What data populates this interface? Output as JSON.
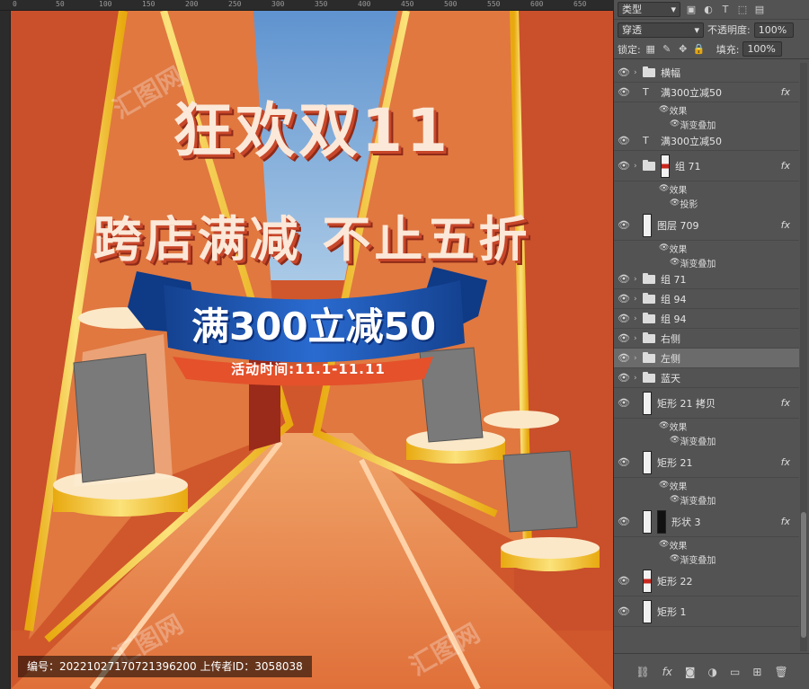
{
  "ruler": {
    "marks": [
      "0",
      "50",
      "100",
      "150",
      "200",
      "250",
      "300",
      "350",
      "400",
      "450",
      "500",
      "550",
      "600",
      "650"
    ]
  },
  "poster": {
    "headline1": "狂欢双11",
    "headline2": "跨店满减  不止五折",
    "banner": "满300立减50",
    "time": "活动时间:11.1-11.11",
    "watermark_text": "汇图网",
    "footer": "编号：20221027170721396200 上传者ID：3058038"
  },
  "colors": {
    "bg": "#d0572b",
    "gold": "#f2c230",
    "blue": "#1b4fa8",
    "road": "#e98a4c",
    "sky": "#6ea4d6"
  },
  "panel": {
    "filter_label": "类型",
    "blend_mode": "穿透",
    "opacity_label": "不透明度:",
    "opacity_value": "100%",
    "lock_label": "锁定:",
    "fill_label": "填充:",
    "fill_value": "100%",
    "layers": [
      {
        "name": "横幅",
        "kind": "folder",
        "fx": false
      },
      {
        "name": "满300立减50",
        "kind": "text",
        "fx": true
      },
      {
        "name": "效果",
        "kind": "sub"
      },
      {
        "name": "渐变叠加",
        "kind": "sub2"
      },
      {
        "name": "满300立减50",
        "kind": "text",
        "fx": false
      },
      {
        "name": "组 71",
        "kind": "group-thumb",
        "fx": true
      },
      {
        "name": "效果",
        "kind": "sub"
      },
      {
        "name": "投影",
        "kind": "sub2"
      },
      {
        "name": "图层 709",
        "kind": "layer",
        "fx": true
      },
      {
        "name": "效果",
        "kind": "sub"
      },
      {
        "name": "渐变叠加",
        "kind": "sub2"
      },
      {
        "name": "组 71",
        "kind": "folder",
        "fx": false
      },
      {
        "name": "组 94",
        "kind": "folder",
        "fx": false
      },
      {
        "name": "组 94",
        "kind": "folder",
        "fx": false
      },
      {
        "name": "右侧",
        "kind": "folder",
        "fx": false
      },
      {
        "name": "左侧",
        "kind": "folder",
        "fx": false,
        "selected": true
      },
      {
        "name": "蓝天",
        "kind": "folder",
        "fx": false
      },
      {
        "name": "矩形 21 拷贝",
        "kind": "layer",
        "fx": true
      },
      {
        "name": "效果",
        "kind": "sub"
      },
      {
        "name": "渐变叠加",
        "kind": "sub2"
      },
      {
        "name": "矩形 21",
        "kind": "layer",
        "fx": true
      },
      {
        "name": "效果",
        "kind": "sub"
      },
      {
        "name": "渐变叠加",
        "kind": "sub2"
      },
      {
        "name": "形状 3",
        "kind": "shape",
        "fx": true
      },
      {
        "name": "效果",
        "kind": "sub"
      },
      {
        "name": "渐变叠加",
        "kind": "sub2"
      },
      {
        "name": "矩形 22",
        "kind": "layer-red",
        "fx": false
      },
      {
        "name": "矩形 1",
        "kind": "layer",
        "fx": false
      }
    ],
    "bottom_icons": [
      "link-icon",
      "fx-icon",
      "mask-icon",
      "adjustment-icon",
      "folder-icon",
      "new-layer-icon",
      "trash-icon"
    ]
  }
}
